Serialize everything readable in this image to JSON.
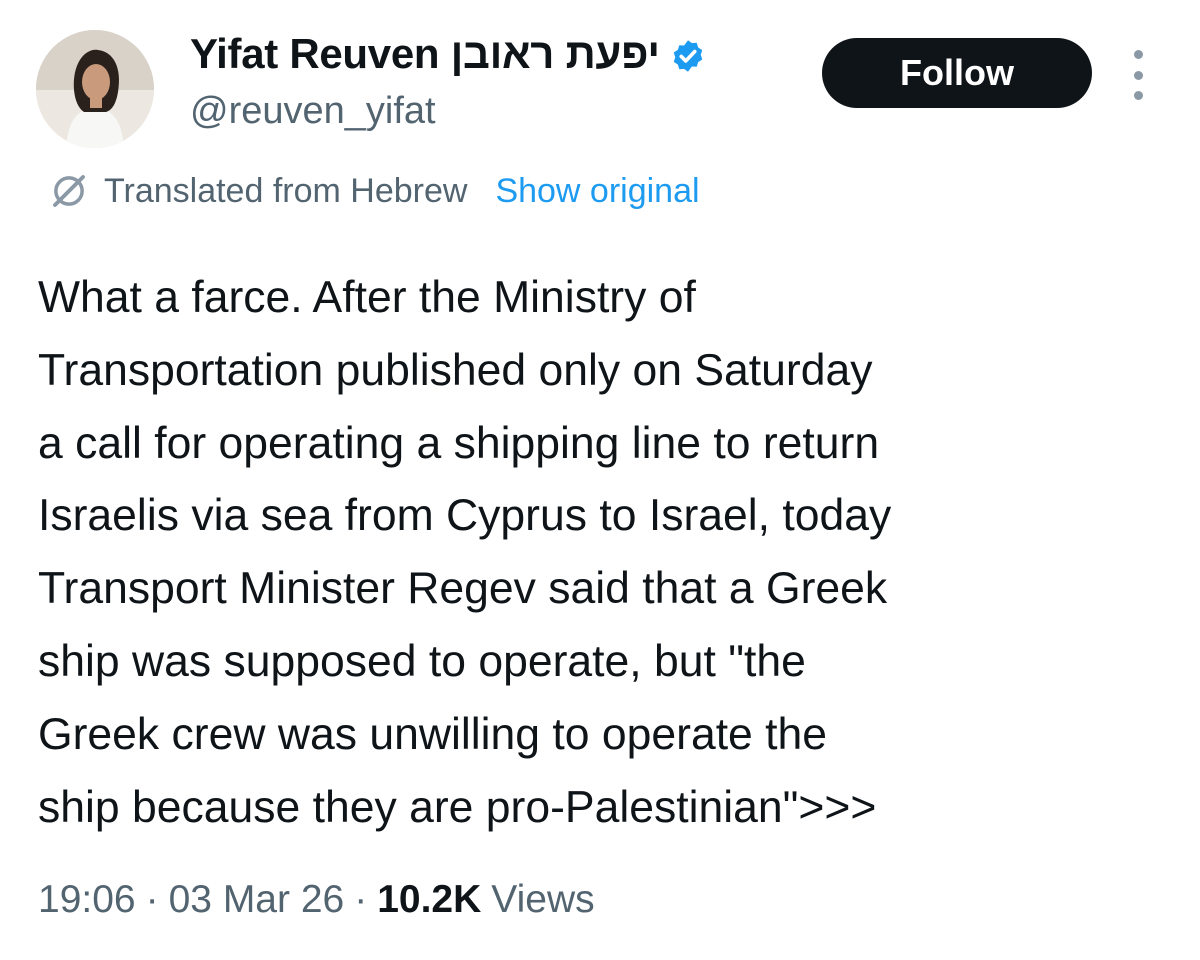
{
  "author": {
    "display_name": "Yifat Reuven יפעת ראובן",
    "handle": "@reuven_yifat",
    "verified": true,
    "avatar_icon": "profile-photo"
  },
  "actions": {
    "follow_label": "Follow",
    "more_icon": "more-vertical-icon"
  },
  "translation": {
    "icon": "translate-icon",
    "label": "Translated from Hebrew",
    "show_original_label": "Show original"
  },
  "tweet": {
    "text": "What a farce. After the Ministry of\nTransportation published only on Saturday\na call for operating a shipping line to return\nIsraelis via sea from Cyprus to Israel, today\nTransport Minister Regev said that a Greek\nship was supposed to operate, but \"the\nGreek crew was unwilling to operate the\nship because they are pro-Palestinian\">>>"
  },
  "meta": {
    "time": "19:06",
    "separator": "·",
    "date": "03 Mar 26",
    "views_count": "10.2K",
    "views_label": "Views"
  },
  "colors": {
    "text_primary": "#0f1419",
    "text_secondary": "#536471",
    "accent": "#1d9bf0",
    "follow_bg": "#0f1419"
  }
}
